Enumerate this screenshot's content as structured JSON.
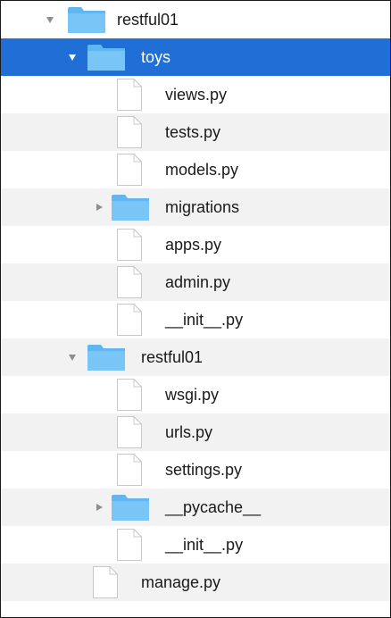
{
  "tree": {
    "root": {
      "label": "restful01"
    },
    "toys": {
      "label": "toys",
      "children": {
        "views": "views.py",
        "tests": "tests.py",
        "models": "models.py",
        "migrations": "migrations",
        "apps": "apps.py",
        "admin": "admin.py",
        "init": "__init__.py"
      }
    },
    "restful01": {
      "label": "restful01",
      "children": {
        "wsgi": "wsgi.py",
        "urls": "urls.py",
        "settings": "settings.py",
        "pycache": "__pycache__",
        "init": "__init__.py"
      }
    },
    "manage": "manage.py"
  },
  "colors": {
    "selection": "#1f6fd6",
    "folder": "#5fb6f0",
    "row_alternate": "#f2f2f2"
  },
  "selected_item": "toys"
}
